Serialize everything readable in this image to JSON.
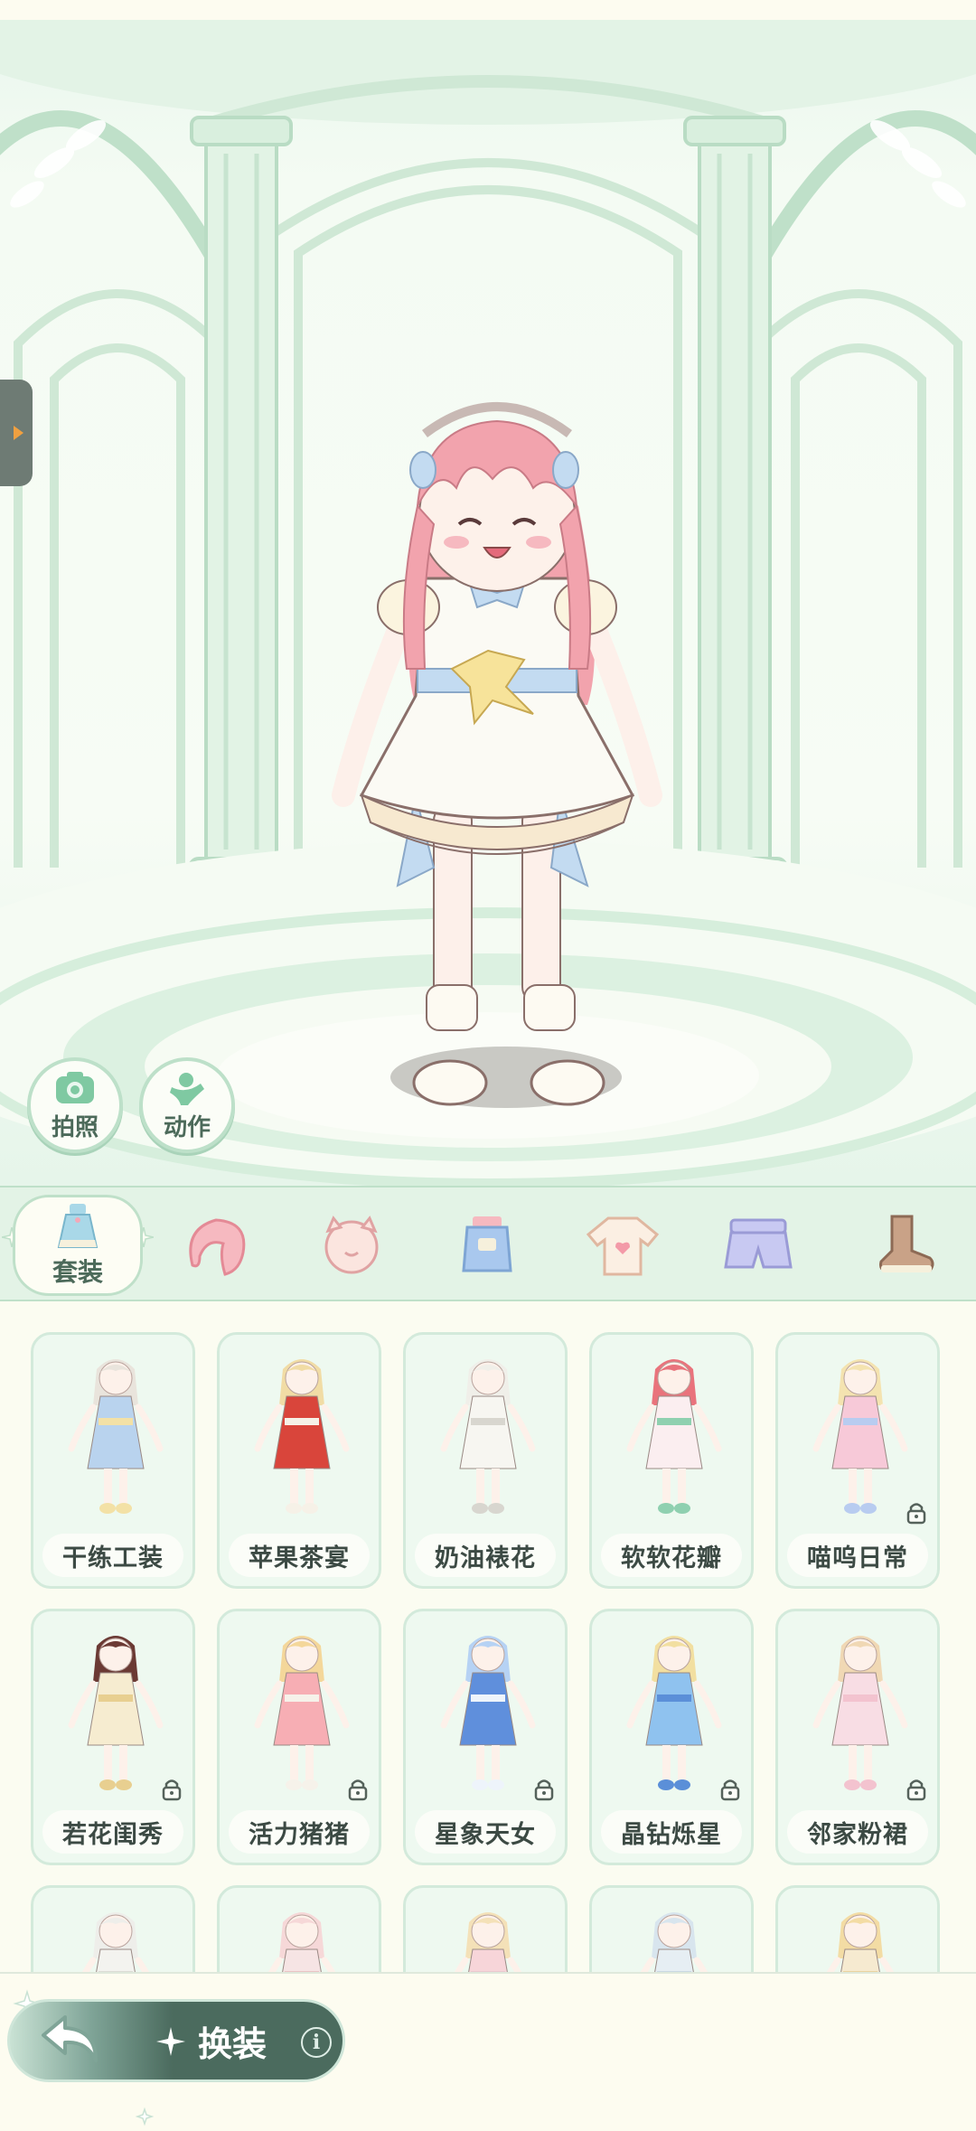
{
  "scene": {
    "left_buttons": [
      {
        "id": "photo",
        "label": "拍照",
        "icon": "camera-icon"
      },
      {
        "id": "action",
        "label": "动作",
        "icon": "pose-icon"
      }
    ],
    "side_tab_icon": "expand-arrow-icon"
  },
  "categories": [
    {
      "id": "outfit",
      "label": "套装",
      "icon": "dress-icon",
      "active": true
    },
    {
      "id": "hair",
      "label": "",
      "icon": "hair-icon"
    },
    {
      "id": "face",
      "label": "",
      "icon": "face-icon"
    },
    {
      "id": "dress",
      "label": "",
      "icon": "overalls-icon"
    },
    {
      "id": "top",
      "label": "",
      "icon": "tshirt-icon"
    },
    {
      "id": "bottom",
      "label": "",
      "icon": "shorts-icon"
    },
    {
      "id": "shoes",
      "label": "",
      "icon": "boot-icon"
    }
  ],
  "outfits": [
    {
      "name": "干练工装",
      "locked": false,
      "hair": "#e9e4dc",
      "dress": "#b9d3ee",
      "accent": "#f3e1a6"
    },
    {
      "name": "苹果茶宴",
      "locked": false,
      "hair": "#f1dca5",
      "dress": "#d9453b",
      "accent": "#f6f1e7"
    },
    {
      "name": "奶油裱花",
      "locked": false,
      "hair": "#f0efe9",
      "dress": "#f7f6f1",
      "accent": "#d8d6cf"
    },
    {
      "name": "软软花瓣",
      "locked": false,
      "hair": "#e9737c",
      "dress": "#fbeef0",
      "accent": "#8fd0b0"
    },
    {
      "name": "喵呜日常",
      "locked": true,
      "hair": "#f4e3b0",
      "dress": "#f7c9d8",
      "accent": "#b8ccf0"
    },
    {
      "name": "若花闺秀",
      "locked": true,
      "hair": "#6b3a34",
      "dress": "#f6ecd0",
      "accent": "#e8cf90"
    },
    {
      "name": "活力猪猪",
      "locked": true,
      "hair": "#f4d79a",
      "dress": "#f7aeb4",
      "accent": "#f6f2ea"
    },
    {
      "name": "星象天女",
      "locked": true,
      "hair": "#b6d2f4",
      "dress": "#5f8fdc",
      "accent": "#eef4fb"
    },
    {
      "name": "晶钻烁星",
      "locked": true,
      "hair": "#f2dfa0",
      "dress": "#8fc2ef",
      "accent": "#5b8fd8"
    },
    {
      "name": "邻家粉裙",
      "locked": true,
      "hair": "#f0d8b4",
      "dress": "#f8dde4",
      "accent": "#f3c3cf"
    },
    {
      "name": "",
      "locked": false,
      "hair": "#eeeeea",
      "dress": "#f3f3ef",
      "accent": "#dcdcd6"
    },
    {
      "name": "",
      "locked": false,
      "hair": "#f6d8d8",
      "dress": "#f6e4e4",
      "accent": "#eac4c4"
    },
    {
      "name": "",
      "locked": false,
      "hair": "#f4e1b8",
      "dress": "#f7d5d9",
      "accent": "#eac9cf"
    },
    {
      "name": "",
      "locked": false,
      "hair": "#d8e5ee",
      "dress": "#e6eef3",
      "accent": "#c9d8e3"
    },
    {
      "name": "",
      "locked": false,
      "hair": "#f3dca4",
      "dress": "#f6ead0",
      "accent": "#ead3a0"
    }
  ],
  "bottom_bar": {
    "change_label": "换装",
    "info_label": "i",
    "back_icon": "back-arrow-icon"
  },
  "colors": {
    "accent_green": "#bfe0c9",
    "pill_dark": "#4b6b5e",
    "text_dark": "#3c4a44"
  }
}
